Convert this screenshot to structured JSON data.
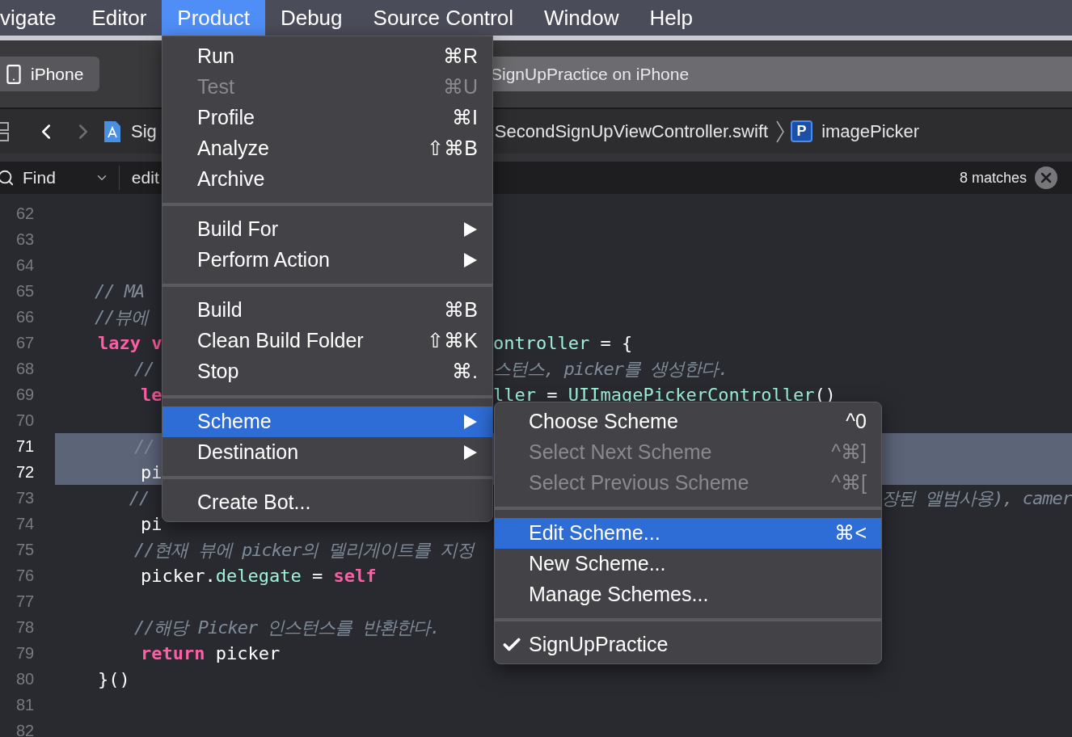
{
  "menubar": [
    {
      "label": "vigate",
      "selected": false
    },
    {
      "label": "Editor",
      "selected": false
    },
    {
      "label": "Product",
      "selected": true
    },
    {
      "label": "Debug",
      "selected": false
    },
    {
      "label": "Source Control",
      "selected": false
    },
    {
      "label": "Window",
      "selected": false
    },
    {
      "label": "Help",
      "selected": false
    }
  ],
  "toolbar": {
    "device": "iPhone",
    "status": "SignUpPractice on iPhone"
  },
  "jump_bar": {
    "project": "Sig",
    "file": "SecondSignUpViewController.swift",
    "symbol_badge": "P",
    "symbol": "imagePicker"
  },
  "find_bar": {
    "mode": "Find",
    "query": "edit",
    "matches": "8 matches"
  },
  "code": [
    {
      "number": "62",
      "highlighted": false
    },
    {
      "number": "63",
      "highlighted": false
    },
    {
      "number": "64",
      "highlighted": false
    },
    {
      "number": "65",
      "highlighted": false,
      "left": [
        {
          "text": "    // MA",
          "kind": "comment"
        }
      ]
    },
    {
      "number": "66",
      "highlighted": false,
      "left": [
        {
          "text": "    //뷰에",
          "kind": "comment"
        }
      ]
    },
    {
      "number": "67",
      "highlighted": false,
      "left": [
        {
          "text": "    lazy v",
          "kind": "keyword"
        }
      ],
      "after_menu": [
        {
          "text": "ontroller",
          "kind": "type"
        },
        {
          "text": " = {",
          "kind": "plain"
        }
      ]
    },
    {
      "number": "68",
      "highlighted": false,
      "left": [
        {
          "text": "        //",
          "kind": "comment"
        }
      ],
      "after_menu": [
        {
          "text": "스턴스, picker를 생성한다.",
          "kind": "comment"
        }
      ]
    },
    {
      "number": "69",
      "highlighted": false,
      "left": [
        {
          "text": "        le",
          "kind": "keyword"
        }
      ],
      "after_menu": [
        {
          "text": "ller",
          "kind": "type"
        },
        {
          "text": " = ",
          "kind": "plain"
        },
        {
          "text": "UIImagePickerController",
          "kind": "type"
        },
        {
          "text": "()",
          "kind": "plain"
        }
      ]
    },
    {
      "number": "70",
      "highlighted": false
    },
    {
      "number": "71",
      "highlighted": true,
      "left": [
        {
          "text": "        //",
          "kind": "comment"
        }
      ]
    },
    {
      "number": "72",
      "highlighted": true,
      "left": [
        {
          "text": "        pi",
          "kind": "plain"
        }
      ]
    },
    {
      "number": "73",
      "highlighted": false,
      "left": [
        {
          "text": "        //",
          "kind": "comment"
        }
      ],
      "after_submenu": [
        {
          "text": "장된 앨범사용), camer",
          "kind": "comment"
        }
      ]
    },
    {
      "number": "74",
      "highlighted": false,
      "left": [
        {
          "text": "        pi",
          "kind": "plain"
        }
      ]
    },
    {
      "number": "75",
      "highlighted": false,
      "left": [
        {
          "text": "        //현재 뷰에 picker의 델리게이트를 지정",
          "kind": "comment"
        }
      ]
    },
    {
      "number": "76",
      "highlighted": false,
      "left": [
        {
          "text": "        picker.",
          "kind": "plain"
        },
        {
          "text": "delegate",
          "kind": "type"
        },
        {
          "text": " = ",
          "kind": "plain"
        },
        {
          "text": "self",
          "kind": "keyword"
        }
      ]
    },
    {
      "number": "77",
      "highlighted": false
    },
    {
      "number": "78",
      "highlighted": false,
      "left": [
        {
          "text": "        //해당 Picker 인스턴스를 반환한다.",
          "kind": "comment"
        }
      ]
    },
    {
      "number": "79",
      "highlighted": false,
      "left": [
        {
          "text": "        return",
          "kind": "keyword"
        },
        {
          "text": " picker",
          "kind": "plain"
        }
      ]
    },
    {
      "number": "80",
      "highlighted": false,
      "left": [
        {
          "text": "    }()",
          "kind": "plain"
        }
      ]
    },
    {
      "number": "81",
      "highlighted": false
    },
    {
      "number": "82",
      "highlighted": false
    }
  ],
  "product_menu": [
    {
      "kind": "item",
      "label": "Run",
      "shortcut": "⌘R",
      "disabled": false,
      "selected": false
    },
    {
      "kind": "item",
      "label": "Test",
      "shortcut": "⌘U",
      "disabled": true,
      "selected": false
    },
    {
      "kind": "item",
      "label": "Profile",
      "shortcut": "⌘I",
      "disabled": false,
      "selected": false
    },
    {
      "kind": "item",
      "label": "Analyze",
      "shortcut": "⇧⌘B",
      "disabled": false,
      "selected": false
    },
    {
      "kind": "item",
      "label": "Archive",
      "disabled": false,
      "selected": false
    },
    {
      "kind": "separator"
    },
    {
      "kind": "submenu",
      "label": "Build For",
      "disabled": false,
      "selected": false
    },
    {
      "kind": "submenu",
      "label": "Perform Action",
      "disabled": false,
      "selected": false
    },
    {
      "kind": "separator"
    },
    {
      "kind": "item",
      "label": "Build",
      "shortcut": "⌘B",
      "disabled": false,
      "selected": false
    },
    {
      "kind": "item",
      "label": "Clean Build Folder",
      "shortcut": "⇧⌘K",
      "disabled": false,
      "selected": false
    },
    {
      "kind": "item",
      "label": "Stop",
      "shortcut": "⌘.",
      "disabled": false,
      "selected": false
    },
    {
      "kind": "separator"
    },
    {
      "kind": "submenu",
      "label": "Scheme",
      "disabled": false,
      "selected": true
    },
    {
      "kind": "submenu",
      "label": "Destination",
      "disabled": false,
      "selected": false
    },
    {
      "kind": "separator"
    },
    {
      "kind": "item",
      "label": "Create Bot...",
      "disabled": false,
      "selected": false
    }
  ],
  "scheme_menu": [
    {
      "kind": "item",
      "label": "Choose Scheme",
      "shortcut": "^0",
      "disabled": false,
      "selected": false,
      "checked": false
    },
    {
      "kind": "item",
      "label": "Select Next Scheme",
      "shortcut": "^⌘]",
      "disabled": true,
      "selected": false,
      "checked": false
    },
    {
      "kind": "item",
      "label": "Select Previous Scheme",
      "shortcut": "^⌘[",
      "disabled": true,
      "selected": false,
      "checked": false
    },
    {
      "kind": "separator"
    },
    {
      "kind": "item",
      "label": "Edit Scheme...",
      "shortcut": "⌘<",
      "disabled": false,
      "selected": true,
      "checked": false
    },
    {
      "kind": "item",
      "label": "New Scheme...",
      "disabled": false,
      "selected": false,
      "checked": false
    },
    {
      "kind": "item",
      "label": "Manage Schemes...",
      "disabled": false,
      "selected": false,
      "checked": false
    },
    {
      "kind": "separator"
    },
    {
      "kind": "item",
      "label": "SignUpPractice",
      "disabled": false,
      "selected": false,
      "checked": true
    }
  ]
}
